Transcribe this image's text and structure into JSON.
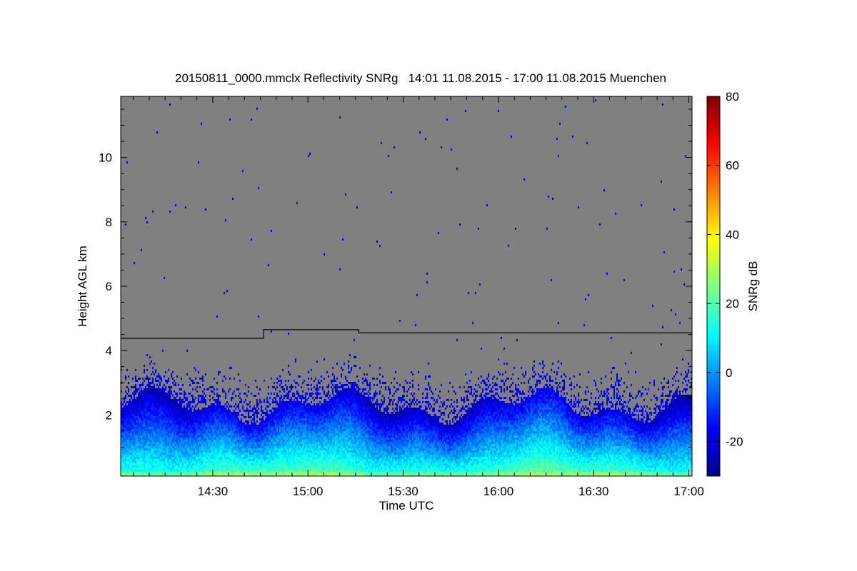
{
  "chart_data": {
    "type": "heatmap",
    "title": "20150811_0000.mmclx Reflectivity SNRg   14:01 11.08.2015 - 17:00 11.08.2015 Muenchen",
    "xlabel": "Time UTC",
    "ylabel": "Height AGL km",
    "colorbar_label": "SNRg dB",
    "xlim_minutes_utc": [
      841,
      1021
    ],
    "ylim": [
      0.1,
      11.9
    ],
    "x_ticks": [
      {
        "label": "14:30",
        "minute": 870
      },
      {
        "label": "15:00",
        "minute": 900
      },
      {
        "label": "15:30",
        "minute": 930
      },
      {
        "label": "16:00",
        "minute": 960
      },
      {
        "label": "16:30",
        "minute": 990
      },
      {
        "label": "17:00",
        "minute": 1020
      }
    ],
    "y_ticks": [
      {
        "label": "2",
        "value": 2
      },
      {
        "label": "4",
        "value": 4
      },
      {
        "label": "6",
        "value": 6
      },
      {
        "label": "8",
        "value": 8
      },
      {
        "label": "10",
        "value": 10
      }
    ],
    "colorbar_range": [
      -30,
      80
    ],
    "colorbar_ticks": [
      {
        "label": "-20",
        "value": -20
      },
      {
        "label": "0",
        "value": 0
      },
      {
        "label": "20",
        "value": 20
      },
      {
        "label": "40",
        "value": 40
      },
      {
        "label": "60",
        "value": 60
      },
      {
        "label": "80",
        "value": 80
      }
    ],
    "colormap": "jet",
    "background_color": "#808080",
    "line_series": {
      "name": "",
      "x_minutes_utc": [
        841,
        886,
        886,
        916,
        916,
        1021
      ],
      "y_km": [
        4.38,
        4.38,
        4.65,
        4.65,
        4.55,
        4.55
      ]
    },
    "signal_layer": {
      "surface_km": 0.1,
      "dense_top_km": 2.3,
      "sparse_top_km": 3.5,
      "surface_snr_db": 20,
      "top_snr_db": -22
    }
  }
}
